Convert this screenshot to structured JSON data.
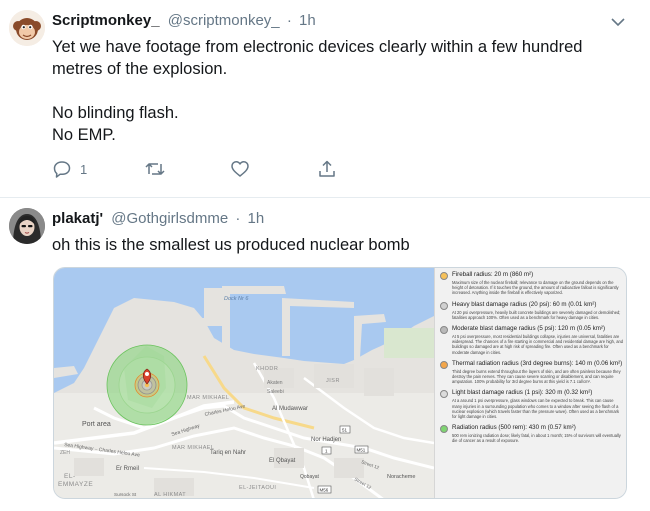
{
  "tweet1": {
    "display_name": "Scriptmonkey_",
    "handle": "@scriptmonkey_",
    "separator": "·",
    "time": "1h",
    "lines": [
      "Yet we have footage from electronic devices clearly within a few hundred",
      "metres of the explosion.",
      "",
      "No blinding flash.",
      "No EMP."
    ],
    "actions": {
      "reply_count": "1",
      "retweet_count": "",
      "like_count": ""
    }
  },
  "tweet2": {
    "display_name": "plakatj'",
    "handle": "@Gothgirlsdmme",
    "separator": "·",
    "time": "1h",
    "text": "oh this is the smallest us produced nuclear bomb"
  },
  "map": {
    "labels": {
      "dock": "Dock Nr 6",
      "port_area": "Port area",
      "khodr": "KHODR",
      "jisr": "JISR",
      "mar_mikhael": "MAR MIKHAEL",
      "mar_mikhael2": "MAR MIKHAEL",
      "akaten_1": "Akaten",
      "akaten_2": "Saleebi",
      "al_mudawwar": "Al Mudawwar",
      "charles_helou": "Charles Helou Ave",
      "charles_helou2": "Sea Highway – Charles Helou Ave",
      "charles_helou3": "Charles Helou Ave",
      "sea_hwy": "Sea Highway",
      "nor_hadjen": "Nor Hadjen",
      "tariq": "Tariq en Nahr",
      "el_qbayat": "El Qbayat",
      "qobayat": "Qobayat",
      "street12": "Street 12",
      "street12b": "Street 12",
      "noracheme": "Noracheme",
      "er_rmeil": "Er Rmeil",
      "el_emmayze": "EL-\nEMMAYZE",
      "emmayze1": "EL-",
      "emmayze2": "EMMAYZE",
      "zeh": "ZEH",
      "sursock": "Sursock St",
      "al_hikmat": "AL HIKMAT",
      "el_jeitaoui": "EL-JEITAOUI",
      "shield_51": "51",
      "shield_1": "1",
      "shield_m51": "M51",
      "shield_m56": "M56"
    }
  },
  "legend": [
    {
      "color": "#f6c15a",
      "title": "Fireball radius: 20 m (860 m²)",
      "desc": "Maximum size of the nuclear fireball; relevance to damage on the ground depends on the height of detonation. If it touches the ground, the amount of radioactive fallout is significantly increased. Anything inside the fireball is effectively vaporized."
    },
    {
      "color": "#d0d0d0",
      "title": "Heavy blast damage radius (20 psi): 60 m (0.01 km²)",
      "desc": "At 20 psi overpressure, heavily built concrete buildings are severely damaged or demolished; fatalities approach 100%. Often used as a benchmark for heavy damage in cities."
    },
    {
      "color": "#b9b9b9",
      "title": "Moderate blast damage radius (5 psi): 120 m (0.05 km²)",
      "desc": "At 5 psi overpressure, most residential buildings collapse, injuries are universal, fatalities are widespread. The chances of a fire starting in commercial and residential damage are high, and buildings so damaged are at high risk of spreading fire. Often used as a benchmark for moderate damage in cities."
    },
    {
      "color": "#f3a64a",
      "title": "Thermal radiation radius (3rd degree burns): 140 m (0.06 km²)",
      "desc": "Third degree burns extend throughout the layers of skin, and are often painless because they destroy the pain nerves. They can cause severe scarring or disablement, and can require amputation. 100% probability for 3rd degree burns at this yield is 7.1 cal/cm²."
    },
    {
      "color": "#dcdcdc",
      "title": "Light blast damage radius (1 psi): 320 m (0.32 km²)",
      "desc": "At a around 1 psi overpressure, glass windows can be expected to break. This can cause many injuries in a surrounding population who comes to a window after seeing the flash of a nuclear explosion (which travels faster than the pressure wave). Often used as a benchmark for light damage in cities."
    },
    {
      "color": "#7fd472",
      "title": "Radiation radius (500 rem): 430 m (0.57 km²)",
      "desc": "500 rem ionizing radiation dose; likely fatal, in about 1 month; 15% of survivors will eventually die of cancer as a result of exposure."
    }
  ]
}
